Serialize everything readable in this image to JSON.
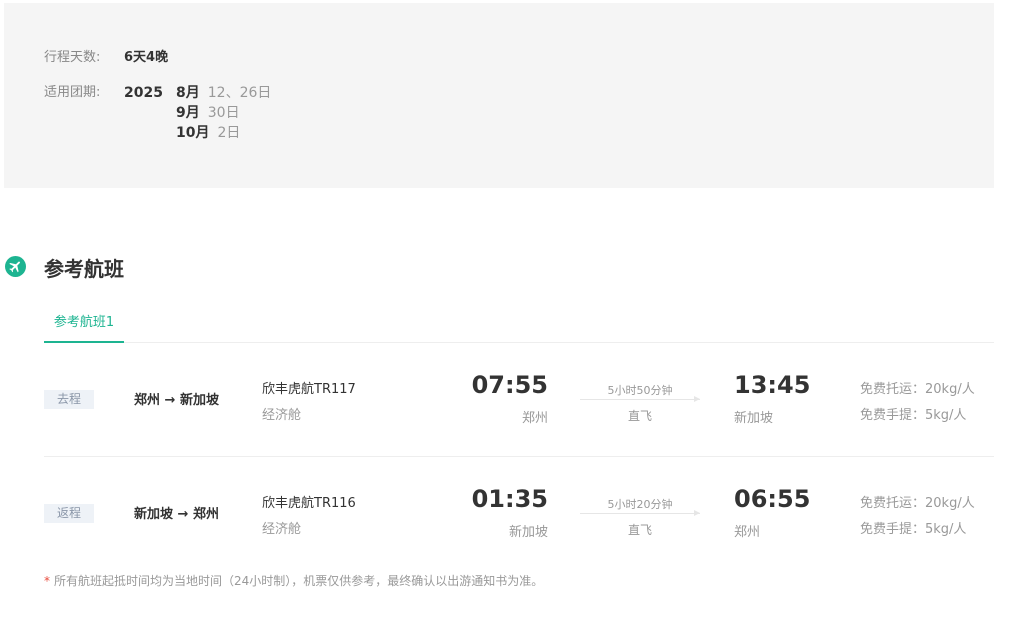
{
  "trip_info": {
    "days_label": "行程天数:",
    "days_value": "6天4晚",
    "dates_label": "适用团期:",
    "year": "2025",
    "months": [
      {
        "month": "8月",
        "days": "12、26日"
      },
      {
        "month": "9月",
        "days": "30日"
      },
      {
        "month": "10月",
        "days": "2日"
      }
    ]
  },
  "section": {
    "icon": "plane-icon",
    "title": "参考航班"
  },
  "tabs": [
    {
      "label": "参考航班1",
      "active": true
    }
  ],
  "flights": [
    {
      "direction": "去程",
      "route": "郑州 → 新加坡",
      "airline": "欣丰虎航TR117",
      "cabin": "经济舱",
      "dep_time": "07:55",
      "dep_city": "郑州",
      "duration": "5小时50分钟",
      "type": "直飞",
      "arr_time": "13:45",
      "arr_city": "新加坡",
      "checked_baggage": "免费托运：20kg/人",
      "carry_on": "免费手提：5kg/人"
    },
    {
      "direction": "返程",
      "route": "新加坡 → 郑州",
      "airline": "欣丰虎航TR116",
      "cabin": "经济舱",
      "dep_time": "01:35",
      "dep_city": "新加坡",
      "duration": "5小时20分钟",
      "type": "直飞",
      "arr_time": "06:55",
      "arr_city": "郑州",
      "checked_baggage": "免费托运：20kg/人",
      "carry_on": "免费手提：5kg/人"
    }
  ],
  "note": {
    "star": "*",
    "text": "所有航班起抵时间均为当地时间（24小时制），机票仅供参考，最终确认以出游通知书为准。"
  },
  "colors": {
    "accent": "#1db491",
    "info_bg": "#f5f5f5",
    "badge_bg": "#eef2f7",
    "note_star": "#e84c3d"
  }
}
